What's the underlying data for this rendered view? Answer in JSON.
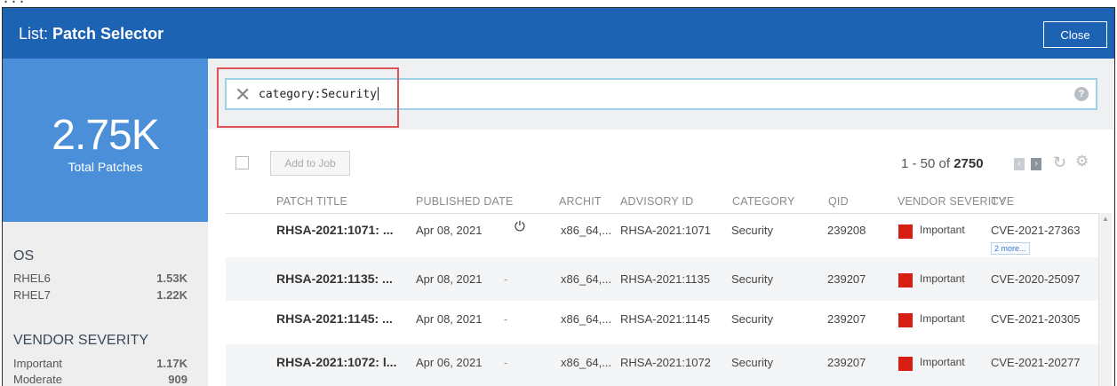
{
  "top_strip_text": "...",
  "window": {
    "title_prefix": "List:",
    "title_name": "Patch Selector",
    "close_label": "Close"
  },
  "summary": {
    "total": "2.75K",
    "label": "Total Patches"
  },
  "facets": [
    {
      "title": "OS",
      "items": [
        {
          "label": "RHEL6",
          "value": "1.53K"
        },
        {
          "label": "RHEL7",
          "value": "1.22K"
        }
      ]
    },
    {
      "title": "VENDOR SEVERITY",
      "items": [
        {
          "label": "Important",
          "value": "1.17K"
        },
        {
          "label": "Moderate",
          "value": "909"
        }
      ]
    }
  ],
  "search": {
    "query": "category:Security",
    "clear_icon": "close-icon",
    "help_icon": "help-icon"
  },
  "toolbar": {
    "add_to_job_label": "Add to Job",
    "pager_range": "1 - 50 of",
    "pager_total": "2750"
  },
  "columns": [
    "PATCH TITLE",
    "PUBLISHED DATE",
    "ARCHIT",
    "ADVISORY ID",
    "CATEGORY",
    "QID",
    "VENDOR SEVERITY",
    "CVE"
  ],
  "rows": [
    {
      "title": "RHSA-2021:1071: ...",
      "date": "Apr 08, 2021",
      "reboot": "power",
      "arch": "x86_64,...",
      "advisory": "RHSA-2021:1071",
      "category": "Security",
      "qid": "239208",
      "severity": "Important",
      "cve": "CVE-2021-27363",
      "cve_more": "2 more..."
    },
    {
      "title": "RHSA-2021:1135: ...",
      "date": "Apr 08, 2021",
      "reboot": "-",
      "arch": "x86_64,...",
      "advisory": "RHSA-2021:1135",
      "category": "Security",
      "qid": "239207",
      "severity": "Important",
      "cve": "CVE-2020-25097",
      "cve_more": ""
    },
    {
      "title": "RHSA-2021:1145: ...",
      "date": "Apr 08, 2021",
      "reboot": "-",
      "arch": "x86_64,...",
      "advisory": "RHSA-2021:1145",
      "category": "Security",
      "qid": "239207",
      "severity": "Important",
      "cve": "CVE-2021-20305",
      "cve_more": ""
    },
    {
      "title": "RHSA-2021:1072: l...",
      "date": "Apr 06, 2021",
      "reboot": "-",
      "arch": "x86_64,...",
      "advisory": "RHSA-2021:1072",
      "category": "Security",
      "qid": "239207",
      "severity": "Important",
      "cve": "CVE-2021-20277",
      "cve_more": ""
    }
  ],
  "colors": {
    "header_blue": "#1d63b4",
    "stat_blue": "#4a8fd8",
    "severity_important": "#d81e12",
    "highlight_red": "#e0525a"
  }
}
